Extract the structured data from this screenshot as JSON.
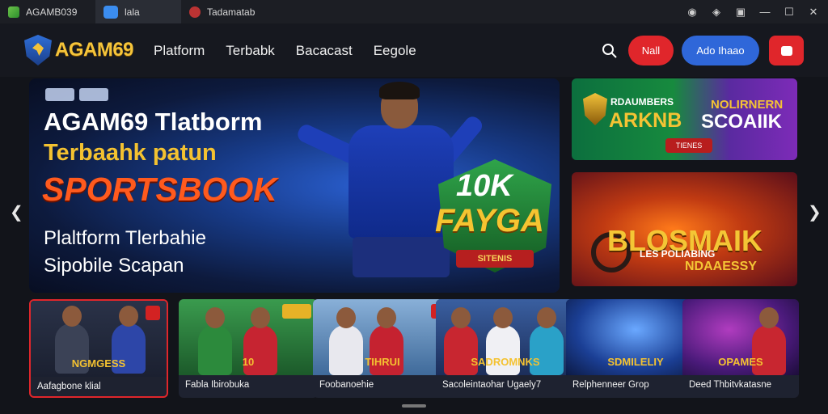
{
  "window": {
    "tabs": [
      {
        "label": "AGAMB039"
      },
      {
        "label": "lala"
      },
      {
        "label": "Tadamatab"
      }
    ]
  },
  "nav": {
    "logo": "AGAM69",
    "menu": [
      "Platform",
      "Terbabk",
      "Bacacast",
      "Eegole"
    ],
    "btn_red": "Nall",
    "btn_blue": "Ado Ihaao"
  },
  "hero": {
    "line1": "AGAM69 Tlatborm",
    "line2": "Terbaahk patun",
    "line3": "SPORTSBOOK",
    "line4": "Plaltform Tlerbahie",
    "line5": "Sipobile Scapan",
    "badge_top": "10K",
    "badge_main": "FAYGA",
    "badge_ribbon": "SITENIS"
  },
  "promos": [
    {
      "a": "RDAUMBERS",
      "b": "ARKNB",
      "c": "NOLIRNERN",
      "d": "SCOAIIK",
      "e": "TIENES"
    },
    {
      "f": "BLOSMAIK",
      "g": "LES POLIABING",
      "h": "NDAAESSY"
    }
  ],
  "cards": [
    {
      "thumb": "NGMGESS",
      "caption": "Aafagbone klial"
    },
    {
      "thumb": "10",
      "caption": "Fabla Ibirobuka"
    },
    {
      "thumb": "TIHRUI",
      "caption": "Foobanoehie"
    },
    {
      "thumb": "SADROMNKS",
      "caption": "Sacoleintaohar Ugaely7"
    },
    {
      "thumb": "SDMILELIY",
      "caption": "Relphenneer Grop"
    },
    {
      "thumb": "OPAMES",
      "caption": "Deed Thbitvkatasne"
    }
  ],
  "colors": {
    "accent_red": "#e0262b",
    "accent_blue": "#2f67d9",
    "gold": "#f4c231",
    "orange": "#ff5a1e"
  }
}
